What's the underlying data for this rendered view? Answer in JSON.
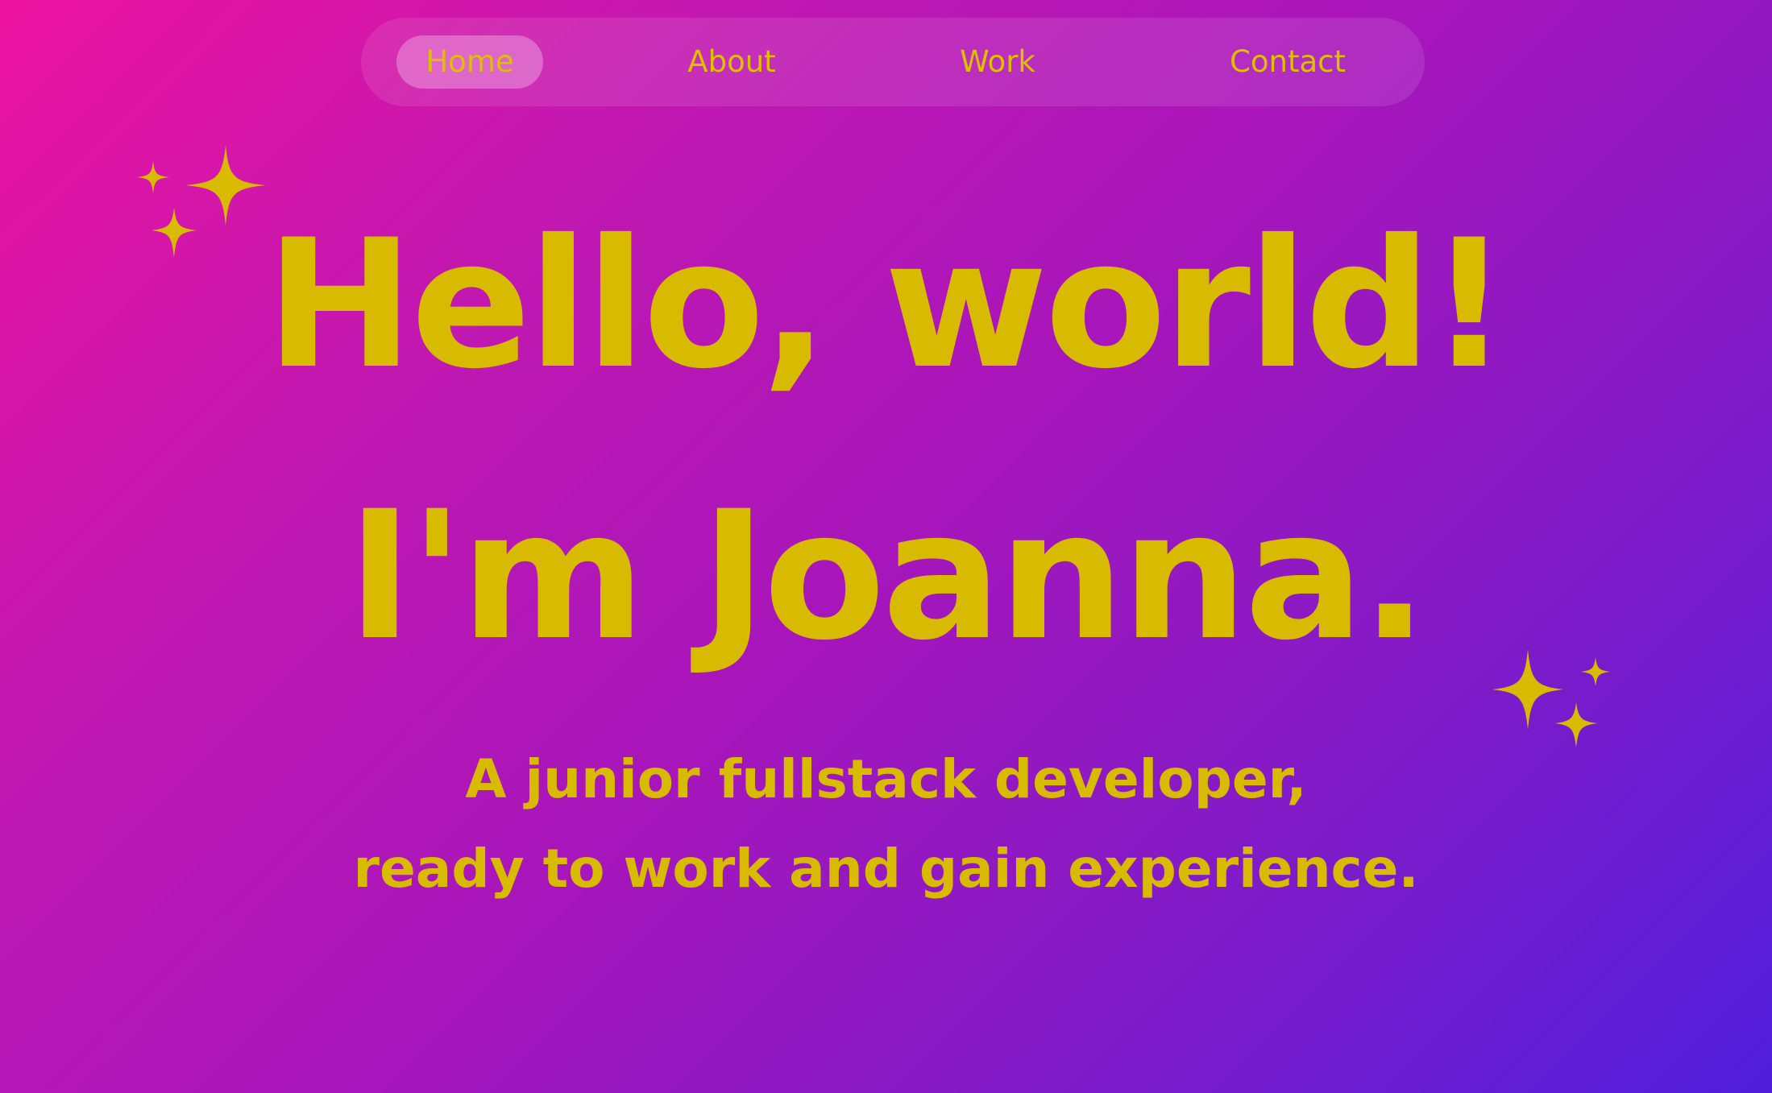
{
  "nav": {
    "items": [
      {
        "label": "Home",
        "active": true
      },
      {
        "label": "About",
        "active": false
      },
      {
        "label": "Work",
        "active": false
      },
      {
        "label": "Contact",
        "active": false
      }
    ]
  },
  "hero": {
    "line1": "Hello, world!",
    "line2": "I'm Joanna.",
    "subtitle_line1": "A junior fullstack developer,",
    "subtitle_line2": "ready to work and gain experience."
  },
  "decorations": {
    "left_icon": "sparkles-icon",
    "right_icon": "sparkles-icon"
  },
  "colors": {
    "accent": "#d8ba00",
    "gradient_start": "#ec139f",
    "gradient_end": "#4f1fdc"
  }
}
